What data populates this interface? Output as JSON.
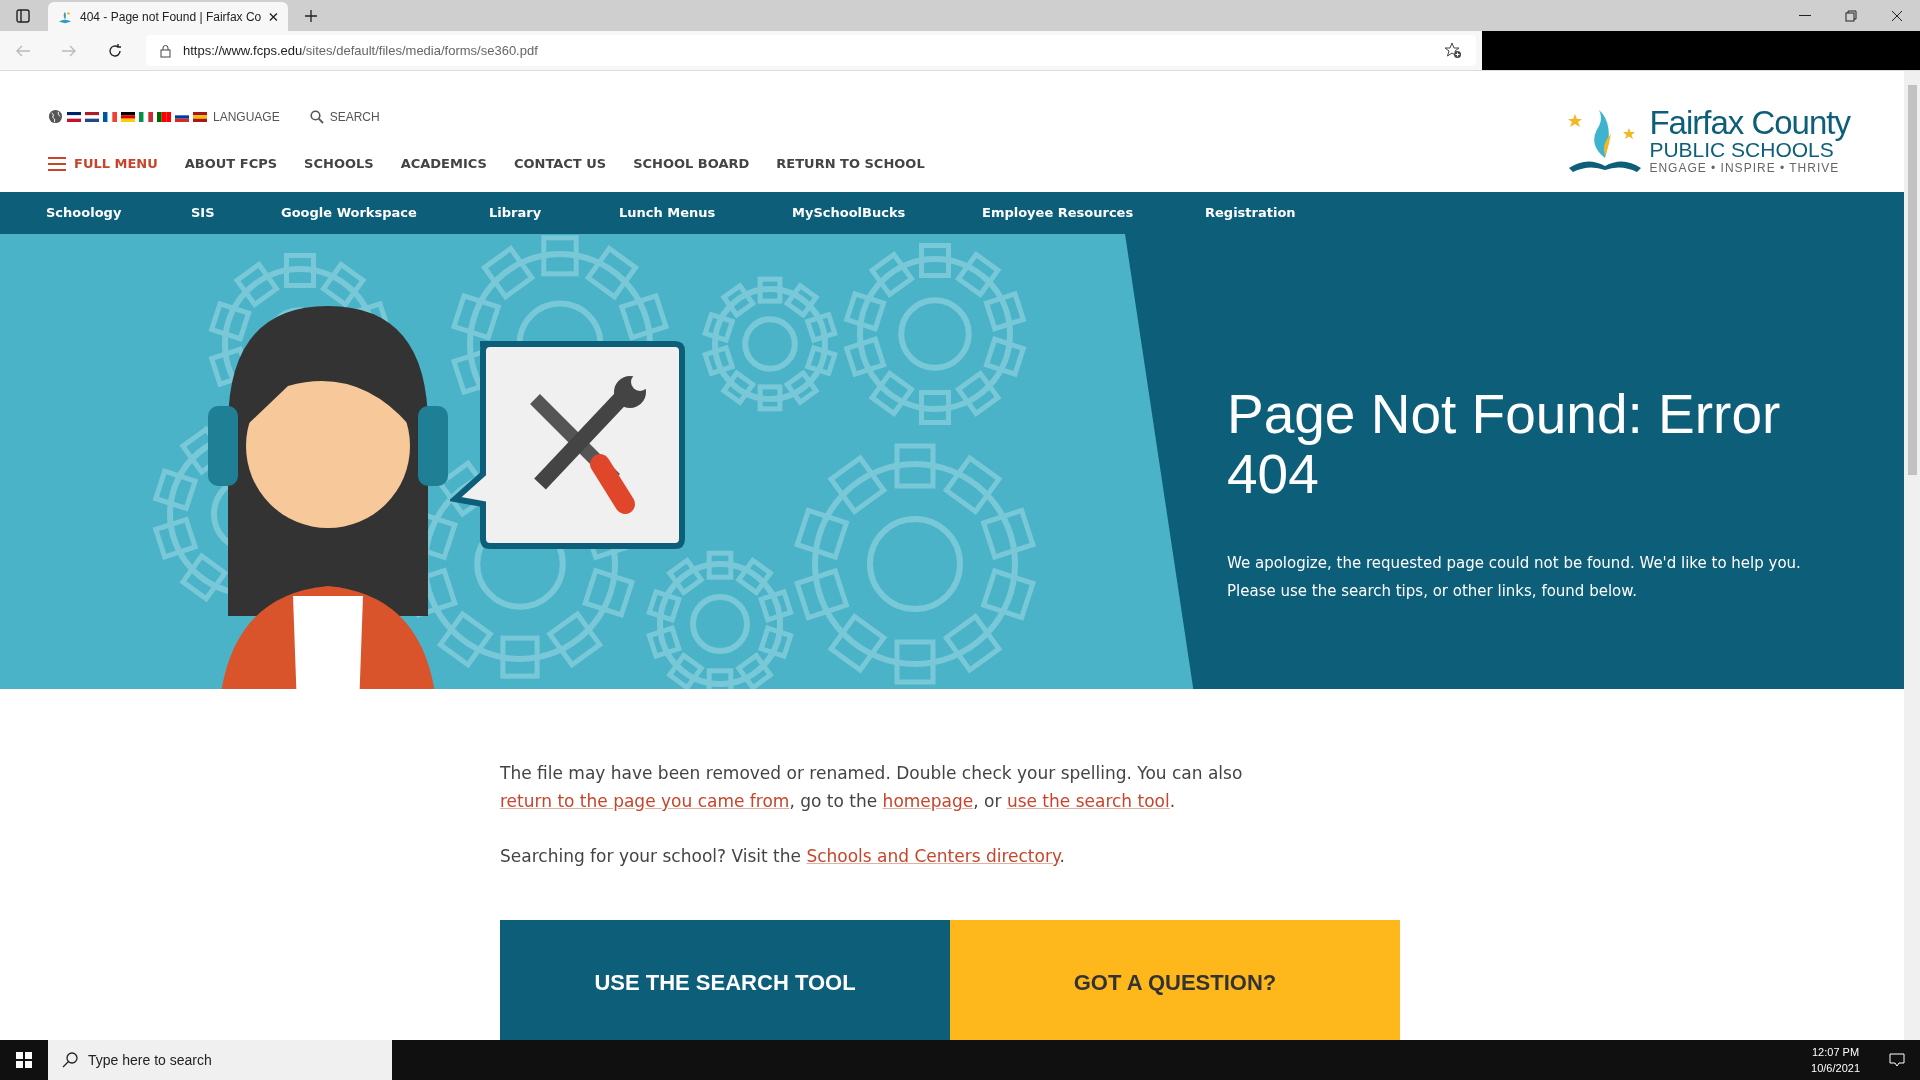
{
  "browser": {
    "tab_title": "404 - Page not Found | Fairfax Co",
    "url_host": "https://www.fcps.edu",
    "url_path": "/sites/default/files/media/forms/se360.pdf"
  },
  "header": {
    "language": "LANGUAGE",
    "search": "SEARCH",
    "full_menu": "FULL MENU",
    "nav": [
      "ABOUT FCPS",
      "SCHOOLS",
      "ACADEMICS",
      "CONTACT US",
      "SCHOOL BOARD",
      "RETURN TO SCHOOL"
    ],
    "logo": {
      "name": "Fairfax County",
      "sub": "PUBLIC SCHOOLS",
      "tagline": "ENGAGE • INSPIRE • THRIVE"
    }
  },
  "quick_links": [
    "Schoology",
    "SIS",
    "Google Workspace",
    "Library",
    "Lunch Menus",
    "MySchoolBucks",
    "Employee Resources",
    "Registration"
  ],
  "hero": {
    "title": "Page Not Found: Error 404",
    "text": "We apologize, the requested page could not be found. We'd like to help you. Please use the search tips, or other links, found below."
  },
  "content": {
    "paragraphs": [
      [
        {
          "kind": "text",
          "text": "The file may have been removed or renamed. Double check your spelling. You can also "
        },
        {
          "kind": "link",
          "text": "return to the page you came from"
        },
        {
          "kind": "text",
          "text": ", go to the "
        },
        {
          "kind": "link",
          "text": "homepage"
        },
        {
          "kind": "text",
          "text": ", or "
        },
        {
          "kind": "link",
          "text": "use the search tool"
        },
        {
          "kind": "text",
          "text": "."
        }
      ],
      [
        {
          "kind": "text",
          "text": "Searching for your school?  Visit the "
        },
        {
          "kind": "link",
          "text": "Schools and Centers directory"
        },
        {
          "kind": "text",
          "text": "."
        }
      ]
    ],
    "cards": [
      {
        "label": "USE THE SEARCH TOOL",
        "color": "#0d5e79"
      },
      {
        "label": "GOT A QUESTION?",
        "color": "#ffb81c"
      }
    ]
  },
  "taskbar": {
    "search_placeholder": "Type here to search",
    "time": "12:07 PM",
    "date": "10/6/2021"
  }
}
